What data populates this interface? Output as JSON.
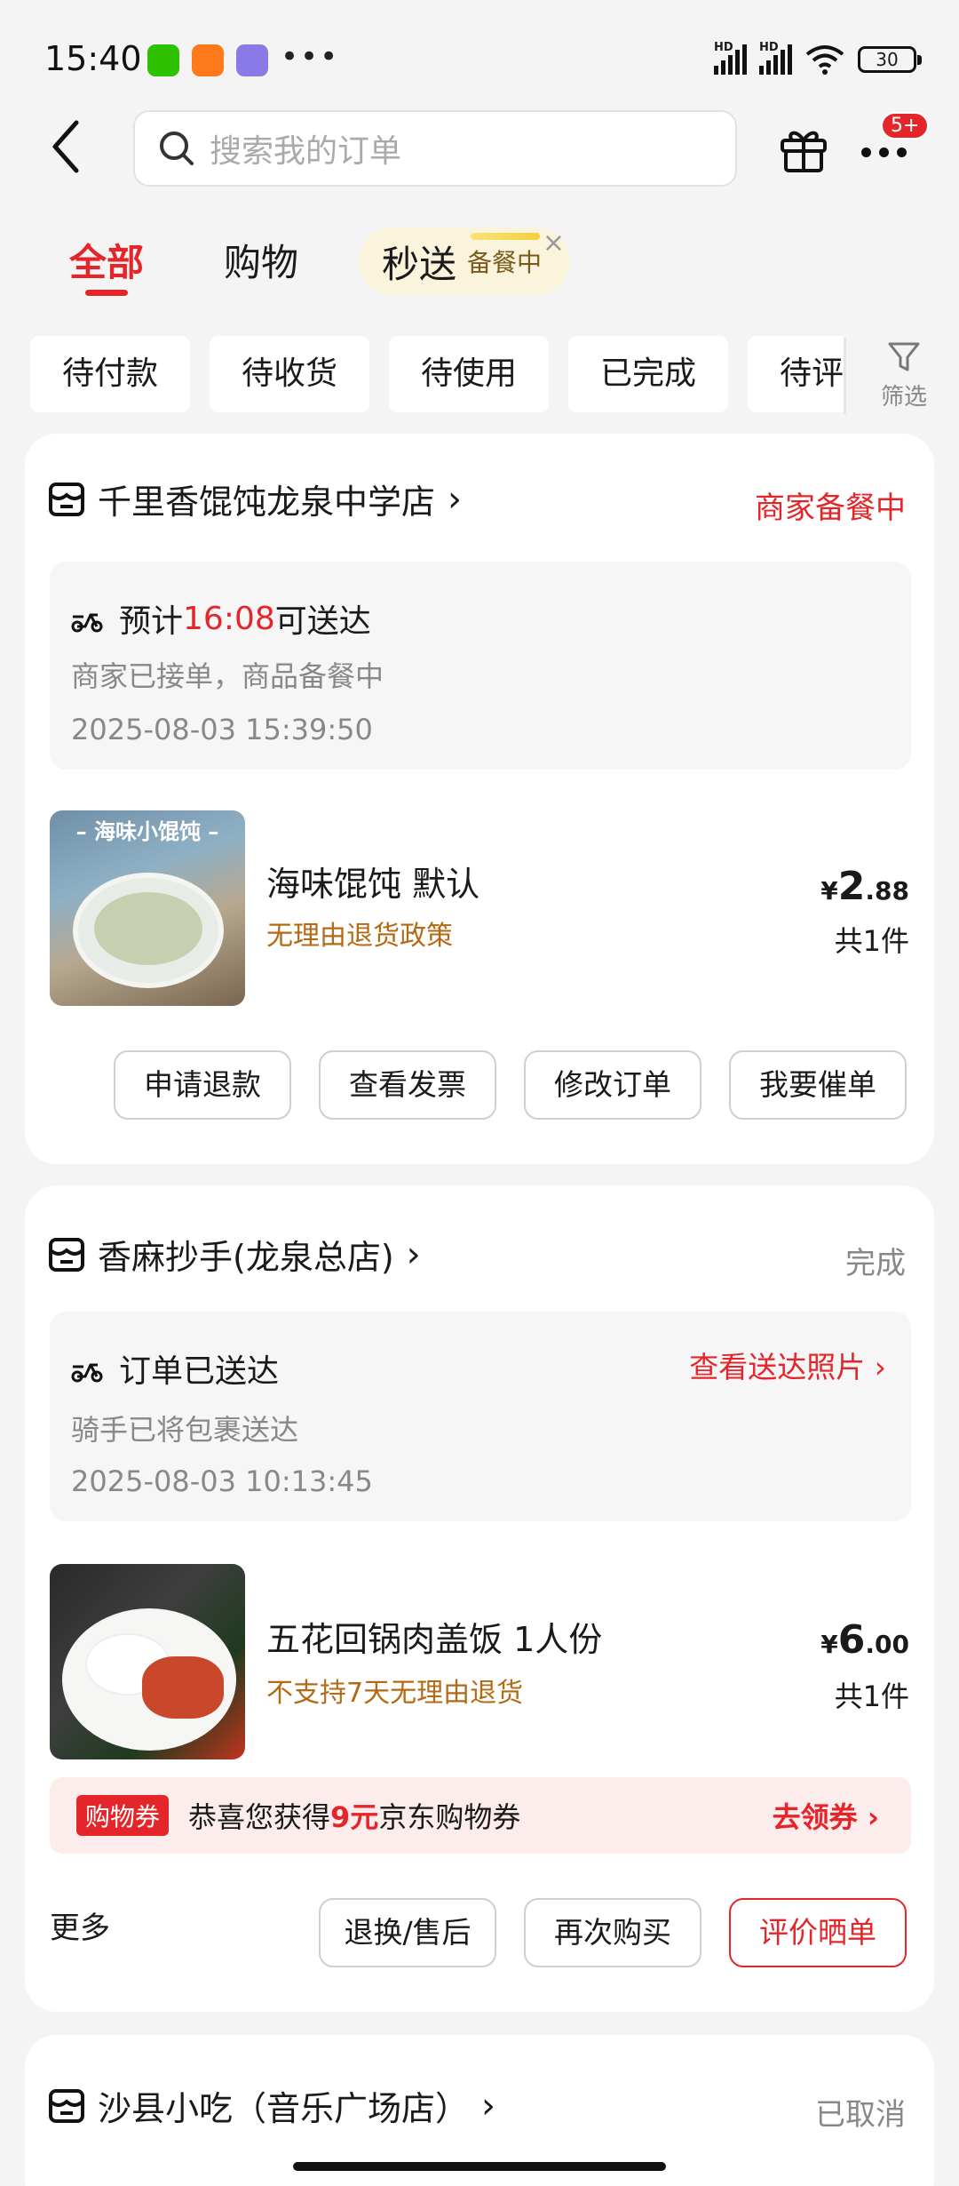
{
  "status_bar": {
    "time": "15:40",
    "app_icons": [
      {
        "name": "wechat-icon",
        "color": "#2dc100"
      },
      {
        "name": "taobao-icon",
        "color": "#ff7a1a"
      },
      {
        "name": "app-icon",
        "color": "#8a7ae8"
      }
    ],
    "more_dots": "•••",
    "signal_hd_1": "HD",
    "signal_hd_2": "HD",
    "battery": "30"
  },
  "header": {
    "search_placeholder": "搜索我的订单",
    "badge": "5+"
  },
  "tabs": {
    "all": "全部",
    "shopping": "购物",
    "flash": "秒送",
    "flash_sub": "备餐中",
    "close": "×"
  },
  "filters": {
    "chips": [
      "待付款",
      "待收货",
      "待使用",
      "已完成",
      "待评价"
    ],
    "filter_label": "筛选"
  },
  "orders": [
    {
      "store": "千里香馄饨龙泉中学店",
      "status": "商家备餐中",
      "eta_prefix": "预计",
      "eta_time": "16:08",
      "eta_suffix": "可送达",
      "sub": "商家已接单，商品备餐中",
      "timestamp": "2025-08-03 15:39:50",
      "item": {
        "name": "海味馄饨 默认",
        "policy": "无理由退货政策",
        "price_currency": "¥",
        "price_int": "2",
        "price_dec": ".88",
        "qty": "共1件",
        "thumb_caption": "– 海味小馄饨 –"
      },
      "buttons": [
        "申请退款",
        "查看发票",
        "修改订单",
        "我要催单"
      ]
    },
    {
      "store": "香麻抄手(龙泉总店)",
      "status": "完成",
      "delivered": "订单已送达",
      "photo_link": "查看送达照片",
      "sub": "骑手已将包裹送达",
      "timestamp": "2025-08-03 10:13:45",
      "item": {
        "name": "五花回锅肉盖饭 1人份",
        "policy": "不支持7天无理由退货",
        "price_currency": "¥",
        "price_int": "6",
        "price_dec": ".00",
        "qty": "共1件"
      },
      "coupon": {
        "tag": "购物券",
        "text_pre": "恭喜您获得",
        "amount": "9元",
        "text_post": "京东购物券",
        "link": "去领券"
      },
      "more": "更多",
      "buttons": [
        "退换/售后",
        "再次购买",
        "评价晒单"
      ]
    },
    {
      "store": "沙县小吃（音乐广场店）",
      "status": "已取消"
    }
  ],
  "colors": {
    "accent": "#e4262a",
    "policy": "#b46a14",
    "background": "#f4f4f4"
  }
}
